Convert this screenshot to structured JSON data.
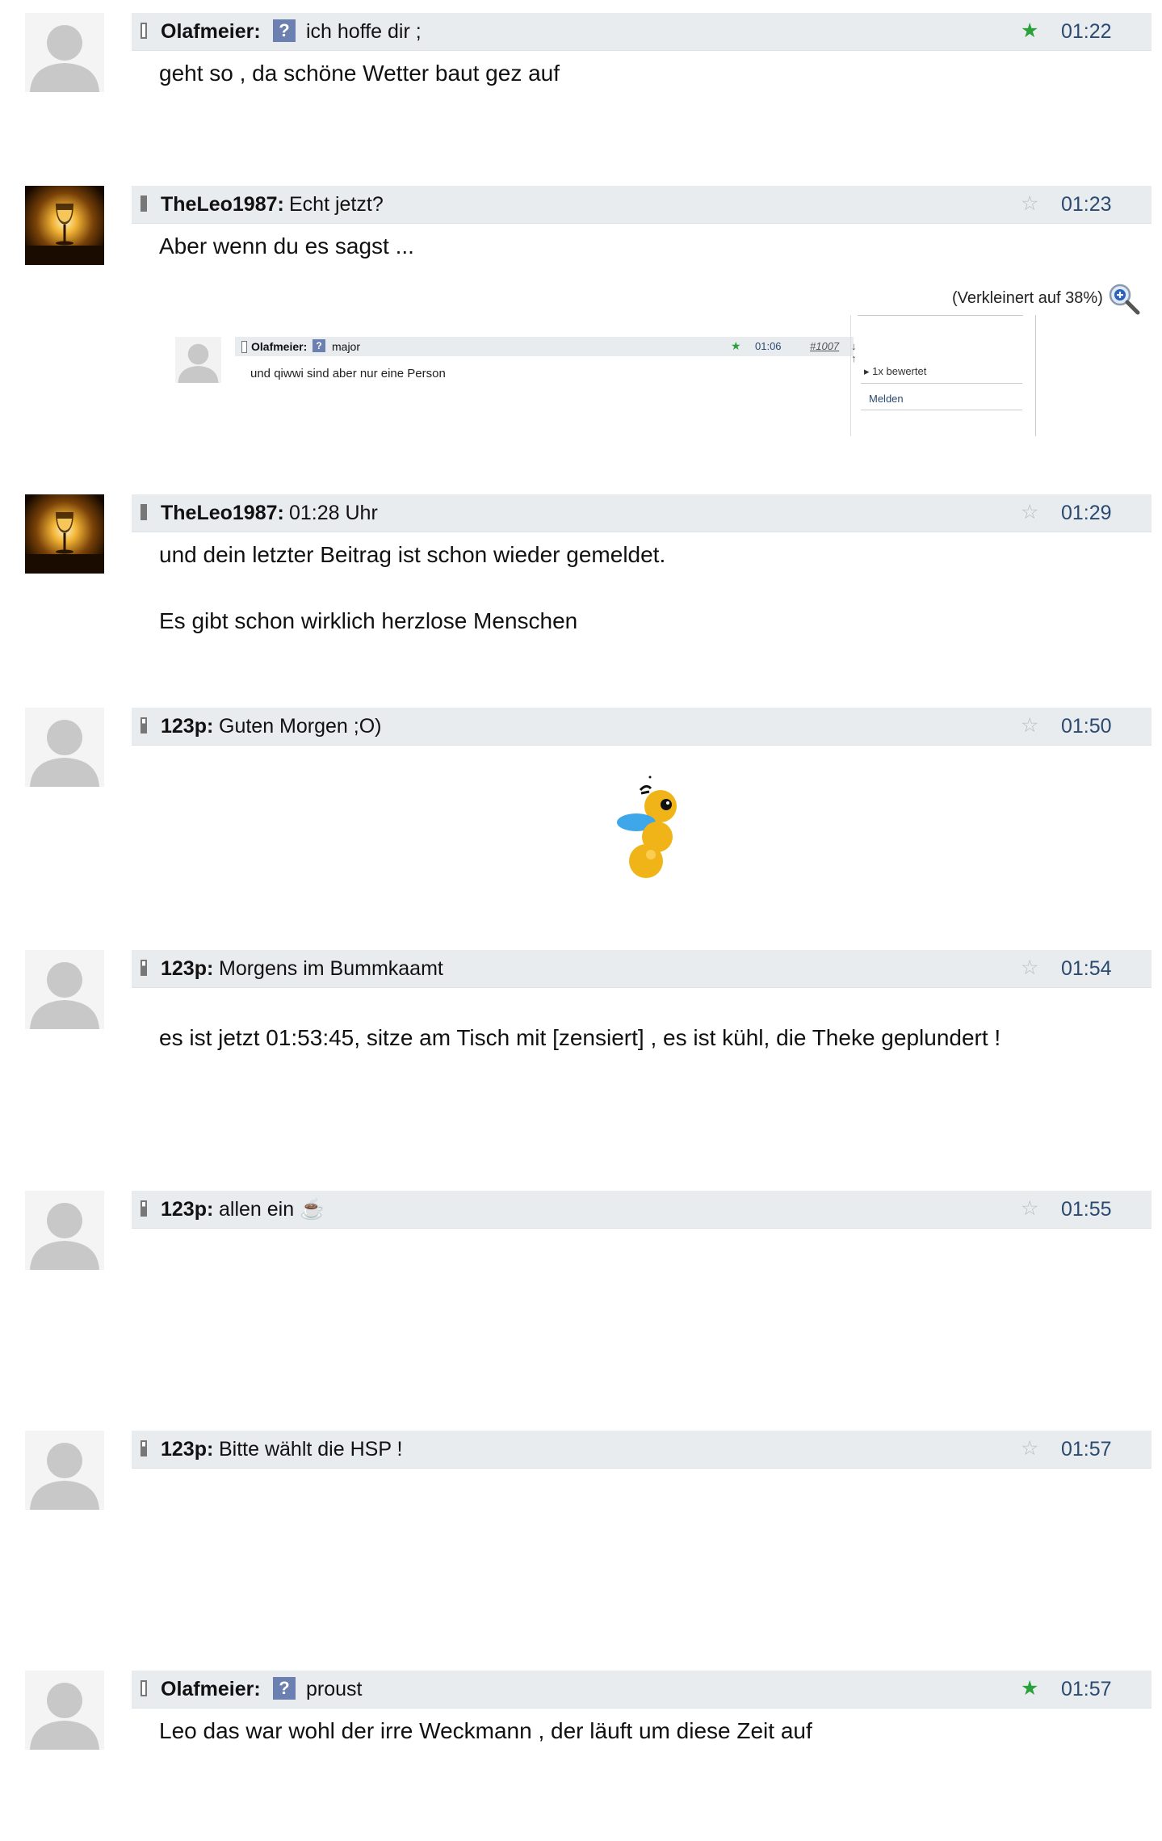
{
  "posts": [
    {
      "user": "Olafmeier:",
      "question_icon": "?",
      "subject": "ich hoffe dir ;",
      "rated": true,
      "time": "01:22",
      "body": [
        "geht so , da schöne Wetter baut gez auf"
      ]
    },
    {
      "user": "TheLeo1987:",
      "subject": "Echt jetzt?",
      "rated": false,
      "time": "01:23",
      "body": [
        "Aber wenn du es sagst ..."
      ],
      "zoom_note": "(Verkleinert auf 38%)",
      "embedded": {
        "user": "Olafmeier:",
        "question_icon": "?",
        "subject": "major",
        "time": "01:06",
        "post_number": "#1007",
        "arrows": "↓ ↑",
        "body": "und qiwwi sind aber nur eine Person",
        "rating_text": "1x bewertet",
        "report_text": "Melden"
      }
    },
    {
      "user": "TheLeo1987:",
      "subject": "01:28 Uhr",
      "rated": false,
      "time": "01:29",
      "body": [
        "und dein letzter Beitrag ist schon wieder gemeldet.",
        "Es gibt schon wirklich herzlose Menschen"
      ]
    },
    {
      "user": "123p:",
      "subject": "Guten Morgen ;O)",
      "rated": false,
      "time": "01:50",
      "body": []
    },
    {
      "user": "123p:",
      "subject": "Morgens im Bummkaamt",
      "rated": false,
      "time": "01:54",
      "body": [
        "es ist jetzt 01:53:45, sitze am Tisch mit [zensiert] , es ist kühl, die Theke geplundert !"
      ]
    },
    {
      "user": "123p:",
      "subject": "allen ein ☕",
      "rated": false,
      "time": "01:55",
      "body": []
    },
    {
      "user": "123p:",
      "subject": "Bitte wählt die HSP !",
      "rated": false,
      "time": "01:57",
      "body": []
    },
    {
      "user": "Olafmeier:",
      "question_icon": "?",
      "subject": "proust",
      "rated": true,
      "time": "01:57",
      "body": [
        "Leo das war wohl der irre Weckmann , der läuft um diese Zeit auf"
      ]
    }
  ],
  "icons": {
    "star_rated": "★",
    "star_empty": "☆",
    "avatar_default": "default-avatar-icon",
    "avatar_theleo": "wine-glass-sunset-avatar",
    "zoom": "magnifier-plus-icon",
    "bee": "animated-bee-smiley"
  },
  "colors": {
    "header_bg": "#e9ecef",
    "time": "#2a4a70",
    "star_rated": "#2aa13a",
    "star_empty": "#b8bcc2",
    "question_icon": "#6b7fb0"
  }
}
